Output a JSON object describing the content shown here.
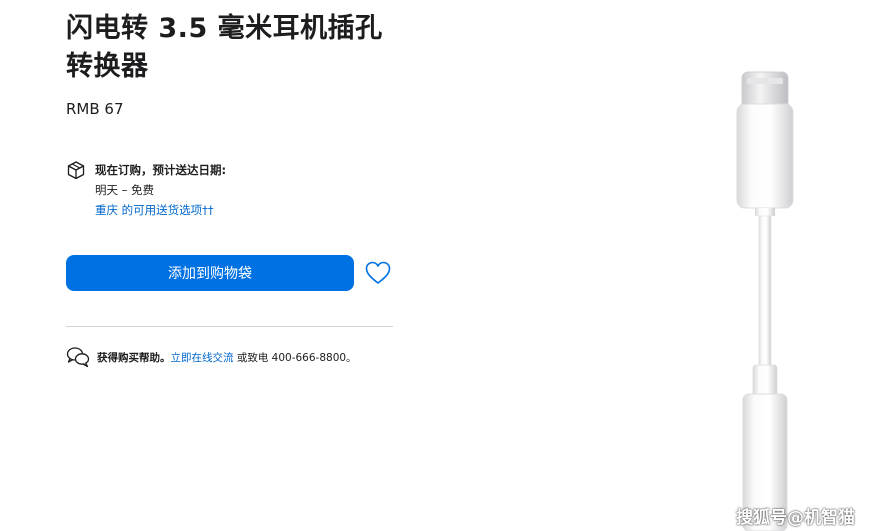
{
  "product": {
    "title": "闪电转 3.5 毫米耳机插孔转换器",
    "price": "RMB 67"
  },
  "delivery": {
    "heading": "现在订购，预计送达日期:",
    "value": "明天 – 免费",
    "link": "重庆 的可用送货选项††"
  },
  "actions": {
    "add_to_bag": "添加到购物袋"
  },
  "help": {
    "label": "获得购买帮助。",
    "chat_link": "立即在线交流",
    "or_call": " 或致电 400-666-8800。"
  },
  "watermark": "搜狐号@机智猫",
  "colors": {
    "accent": "#0071e3",
    "link": "#0066cc"
  },
  "icons": [
    "box-icon",
    "heart-icon",
    "chat-bubbles-icon"
  ]
}
